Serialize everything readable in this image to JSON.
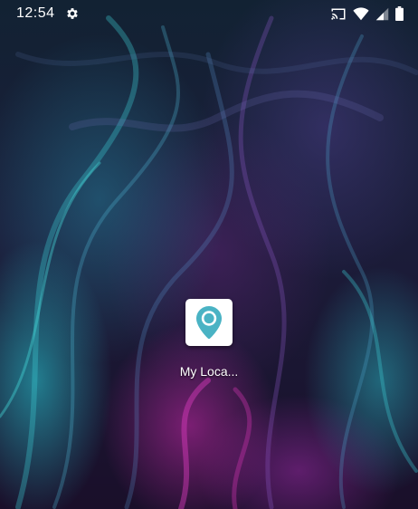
{
  "status_bar": {
    "time": "12:54",
    "icons": [
      "settings-gear-icon",
      "cast-icon",
      "wifi-icon",
      "cellular-signal-icon",
      "battery-icon"
    ]
  },
  "home_screen": {
    "apps": [
      {
        "label": "My Loca...",
        "icon": "location-pin-icon",
        "icon_color": "#4ab3c4"
      }
    ]
  },
  "colors": {
    "status_text": "#ffffff",
    "icon_background": "#ffffff",
    "pin_teal": "#4ab3c4"
  }
}
